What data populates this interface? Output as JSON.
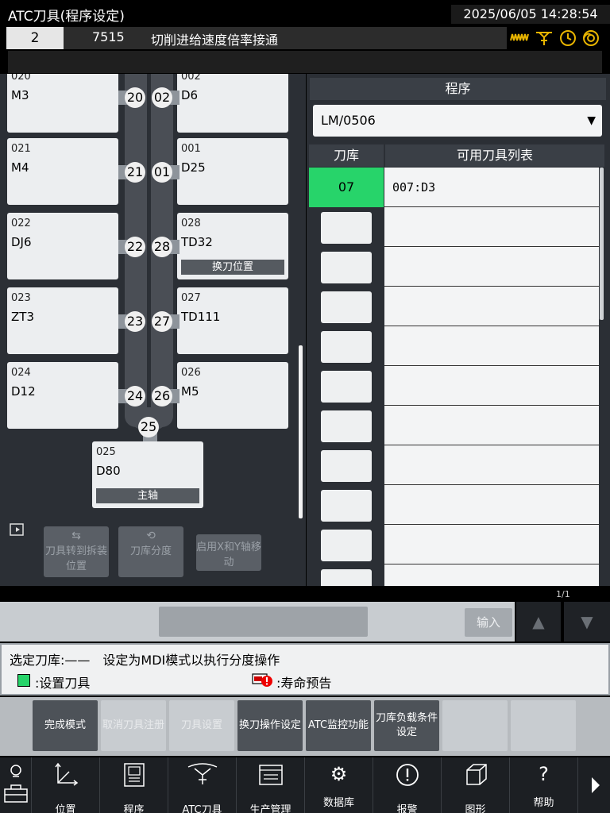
{
  "header": {
    "title": "ATC刀具(程序设定)",
    "datetime": "2025/06/05 14:28:54"
  },
  "status": {
    "program_no": "2",
    "program_id": "7515",
    "message": "切削进给速度倍率接通",
    "icons": [
      "wave-icon",
      "spindle-icon",
      "clock-icon",
      "coolant-icon"
    ]
  },
  "magazine": {
    "left_cards": [
      {
        "no": "020",
        "name": "M3",
        "pot": "20"
      },
      {
        "no": "021",
        "name": "M4",
        "pot": "21"
      },
      {
        "no": "022",
        "name": "DJ6",
        "pot": "22"
      },
      {
        "no": "023",
        "name": "ZT3",
        "pot": "23"
      },
      {
        "no": "024",
        "name": "D12",
        "pot": "24"
      }
    ],
    "right_cards": [
      {
        "no": "002",
        "name": "D6",
        "pot": "02",
        "tag": ""
      },
      {
        "no": "001",
        "name": "D25",
        "pot": "01",
        "tag": ""
      },
      {
        "no": "028",
        "name": "TD32",
        "pot": "28",
        "tag": "换刀位置"
      },
      {
        "no": "027",
        "name": "TD111",
        "pot": "27",
        "tag": ""
      },
      {
        "no": "026",
        "name": "M5",
        "pot": "26",
        "tag": ""
      }
    ],
    "bottom_card": {
      "no": "025",
      "name": "D80",
      "pot": "25",
      "tag": "主轴"
    }
  },
  "left_buttons": [
    {
      "label": "刀具转到拆装位置",
      "icon": "rotate-icon"
    },
    {
      "label": "刀库分度",
      "icon": "index-icon"
    },
    {
      "label": "启用X和Y轴移动",
      "icon": ""
    }
  ],
  "program_panel": {
    "header": "程序",
    "selected": "LM/0506",
    "col_magazine": "刀库",
    "col_tool_list": "可用刀具列表",
    "active_magazine": "07",
    "first_tool": "007:D3"
  },
  "input": {
    "page": "1/1",
    "button": "输入"
  },
  "info": {
    "line1": "选定刀库:——　设定为MDI模式以执行分度操作",
    "legend_set": ":设置刀具",
    "legend_warn": ":寿命预告"
  },
  "softkeys": [
    {
      "label": "完成模式",
      "enabled": true
    },
    {
      "label": "取消刀具注册",
      "enabled": false
    },
    {
      "label": "刀具设置",
      "enabled": false
    },
    {
      "label": "换刀操作设定",
      "enabled": true
    },
    {
      "label": "ATC监控功能",
      "enabled": true
    },
    {
      "label": "刀库负载条件设定",
      "enabled": true
    },
    {
      "label": "",
      "enabled": false
    },
    {
      "label": "",
      "enabled": false
    }
  ],
  "nav": [
    {
      "label": "",
      "icon": "lamp-toolbox-icon"
    },
    {
      "label": "位置",
      "icon": "axis-icon"
    },
    {
      "label": "程序",
      "icon": "program-icon"
    },
    {
      "label": "ATC刀具",
      "icon": "atc-icon"
    },
    {
      "label": "生产管理",
      "icon": "production-icon"
    },
    {
      "label": "数据库",
      "icon": "gear-icon"
    },
    {
      "label": "报警",
      "icon": "alarm-icon"
    },
    {
      "label": "图形",
      "icon": "cube-icon"
    },
    {
      "label": "帮助",
      "icon": "help-icon"
    }
  ]
}
